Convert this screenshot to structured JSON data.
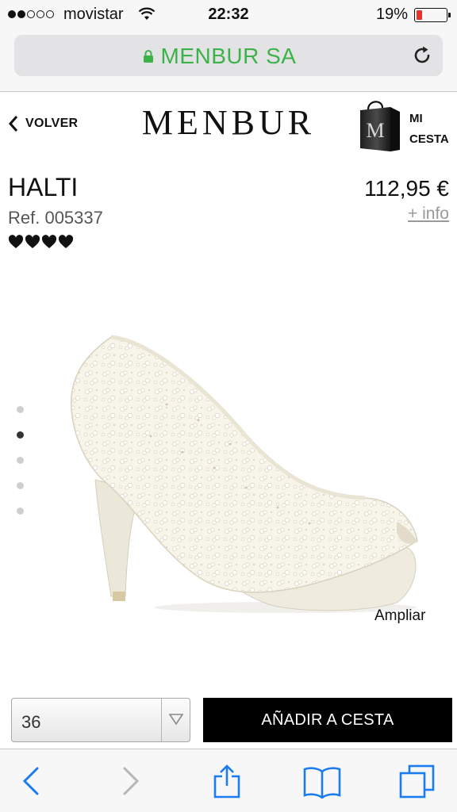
{
  "status_bar": {
    "carrier": "movistar",
    "time": "22:32",
    "battery": "19%",
    "battery_level": 0.19,
    "signal_bars": 2,
    "signal_total": 5
  },
  "browser": {
    "url": "MENBUR SA",
    "secure_color": "#3cb34a",
    "reload_icon": "reload-icon"
  },
  "header": {
    "back_label": "VOLVER",
    "logo": "MENBUR",
    "cart_label": "MI\nCESTA",
    "cart_icon": "shopping-bag-icon"
  },
  "product": {
    "name": "HALTI",
    "ref": "Ref. 005337",
    "price": "112,95 €",
    "more_info": "+ info",
    "rating_hearts": 4,
    "image_count": 5,
    "active_image": 2,
    "zoom_label": "Ampliar"
  },
  "purchase": {
    "size_value": "36",
    "add_label": "AÑADIR A CESTA"
  },
  "toolbar": {
    "items": [
      "back-icon",
      "forward-icon",
      "share-icon",
      "bookmarks-icon",
      "tabs-icon"
    ],
    "accent": "#1a7cf0"
  }
}
